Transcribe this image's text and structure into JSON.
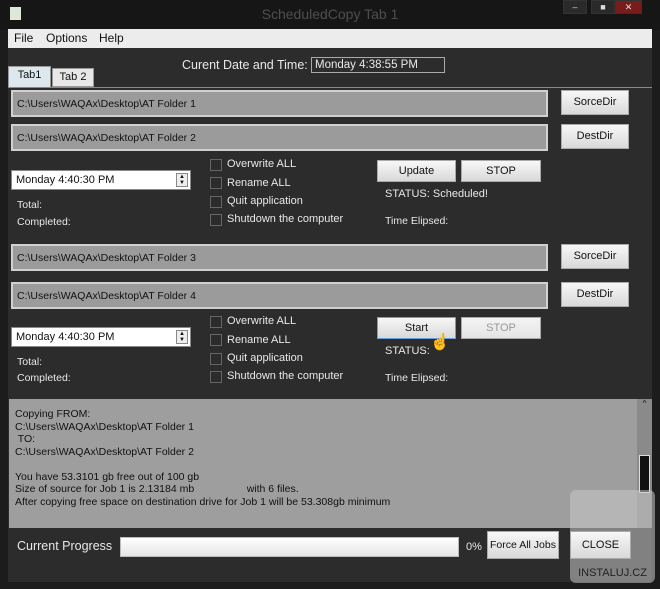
{
  "window": {
    "title": "ScheduledCopy Tab 1"
  },
  "menu": [
    "File",
    "Options",
    "Help"
  ],
  "datetime": {
    "label": "Curent Date and Time:",
    "value": "Monday 4:38:55 PM"
  },
  "tabs": [
    "Tab1",
    "Tab 2"
  ],
  "jobs": [
    {
      "source": "C:\\Users\\WAQAx\\Desktop\\AT Folder 1",
      "dest": "C:\\Users\\WAQAx\\Desktop\\AT Folder 2",
      "source_btn": "SorceDir",
      "dest_btn": "DestDir",
      "time": "Monday 4:40:30 PM",
      "options": [
        "Overwrite ALL",
        "Rename ALL",
        "Quit application",
        "Shutdown the computer"
      ],
      "action_btn": "Update",
      "stop_btn": "STOP",
      "status": "STATUS:  Scheduled!",
      "total": "Total:",
      "completed": "Completed:",
      "elapsed": "Time Elipsed:"
    },
    {
      "source": "C:\\Users\\WAQAx\\Desktop\\AT Folder 3",
      "dest": "C:\\Users\\WAQAx\\Desktop\\AT Folder 4",
      "source_btn": "SorceDir",
      "dest_btn": "DestDir",
      "time": "Monday 4:40:30 PM",
      "options": [
        "Overwrite ALL",
        "Rename ALL",
        "Quit application",
        "Shutdown the computer"
      ],
      "action_btn": "Start",
      "stop_btn": "STOP",
      "status": "STATUS:",
      "total": "Total:",
      "completed": "Completed:",
      "elapsed": "Time Elipsed:"
    }
  ],
  "log": "Copying FROM:\nC:\\Users\\WAQAx\\Desktop\\AT Folder 1\n TO:\nC:\\Users\\WAQAx\\Desktop\\AT Folder 2\n\nYou have 53.3101 gb free out of 100 gb\nSize of source for Job 1 is 2.13184 mb                  with 6 files.\nAfter copying free space on destination drive for Job 1 will be 53.308gb minimum",
  "progress": {
    "label": "Current Progress",
    "value": 0,
    "text": "0%"
  },
  "buttons": {
    "force": "Force All Jobs",
    "close": "CLOSE"
  },
  "watermark": "INSTALUJ.CZ"
}
